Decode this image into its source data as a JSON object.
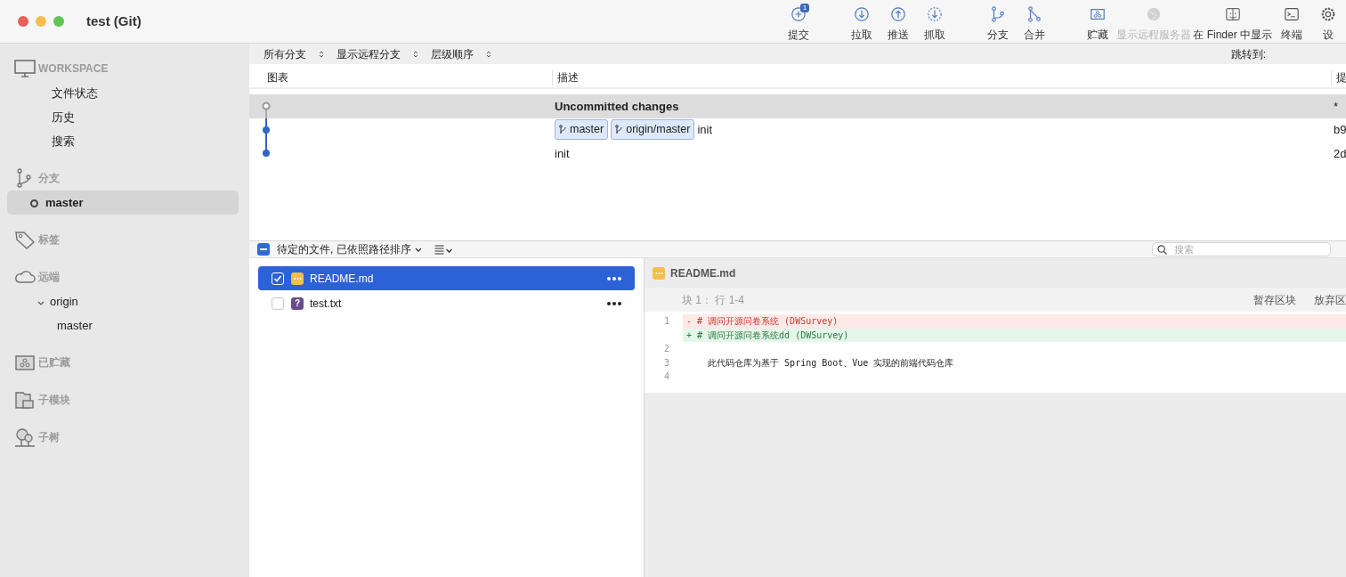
{
  "window": {
    "title": "test (Git)"
  },
  "toolbar": [
    {
      "label": "提交",
      "kind": "commit",
      "badge": "1",
      "disabled": false
    },
    {
      "label": "拉取",
      "kind": "pull",
      "disabled": false
    },
    {
      "label": "推送",
      "kind": "push",
      "disabled": false
    },
    {
      "label": "抓取",
      "kind": "fetch",
      "disabled": false
    },
    {
      "label": "分支",
      "kind": "branch",
      "disabled": false
    },
    {
      "label": "合并",
      "kind": "merge",
      "disabled": false
    },
    {
      "label": "贮藏",
      "kind": "stash",
      "disabled": false
    },
    {
      "label": "显示远程服务器",
      "kind": "remote",
      "disabled": true
    },
    {
      "label": "在 Finder 中显示",
      "kind": "finder",
      "disabled": false
    },
    {
      "label": "终端",
      "kind": "terminal",
      "disabled": false
    },
    {
      "label": "设",
      "kind": "settings",
      "disabled": false
    }
  ],
  "sidebar": {
    "sections": [
      {
        "label": "WORKSPACE",
        "kind": "workspace",
        "items": [
          {
            "label": "文件状态",
            "selected": false
          },
          {
            "label": "历史",
            "selected": false
          },
          {
            "label": "搜索",
            "selected": false
          }
        ]
      },
      {
        "label": "分支",
        "kind": "branch",
        "items": [
          {
            "label": "master",
            "selected": true,
            "current": true
          }
        ]
      },
      {
        "label": "标签",
        "kind": "tag"
      },
      {
        "label": "远端",
        "kind": "remote",
        "items": [
          {
            "label": "origin",
            "selected": false,
            "expanded": true,
            "children": [
              {
                "label": "master",
                "selected": false
              }
            ]
          }
        ]
      },
      {
        "label": "已贮藏",
        "kind": "stash"
      },
      {
        "label": "子模块",
        "kind": "submodule"
      },
      {
        "label": "子树",
        "kind": "subtree"
      }
    ]
  },
  "filters": {
    "selects": [
      "所有分支",
      "显示远程分支",
      "层级顺序"
    ],
    "jump_label": "跳转到:"
  },
  "commits": {
    "columns": [
      "图表",
      "描述",
      "提"
    ],
    "rows": [
      {
        "kind": "uncommitted",
        "description": "Uncommitted changes",
        "refs": [],
        "hash": "*",
        "selected": true
      },
      {
        "kind": "commit",
        "description": "init",
        "refs": [
          "master",
          "origin/master"
        ],
        "hash": "b9",
        "selected": false
      },
      {
        "kind": "commit",
        "description": "init",
        "refs": [],
        "hash": "2d",
        "selected": false
      }
    ]
  },
  "staged": {
    "select_all": {
      "checked": true,
      "mixed": true
    },
    "label": "待定的文件, 已依照路径排序",
    "search": {
      "placeholder": "搜索"
    },
    "files": [
      {
        "name": "README.md",
        "kind": "modified",
        "checked": true,
        "selected": true
      },
      {
        "name": "test.txt",
        "kind": "untracked",
        "glyph": "?",
        "checked": false,
        "selected": false
      }
    ]
  },
  "diff": {
    "file": "README.md",
    "hunk": "块 1：  行 1-4",
    "buttons": [
      "暂存区块",
      "放弃区"
    ],
    "lines": [
      {
        "kind": "removed",
        "number": "1",
        "sign": "-",
        "text": "# 调问开源问卷系统 (DWSurvey)"
      },
      {
        "kind": "added",
        "sign": "+",
        "text": "# 调问开源问卷系统dd (DWSurvey)"
      },
      {
        "kind": "context",
        "number": "2"
      },
      {
        "kind": "context",
        "number": "3",
        "text": "    此代码仓库为基于 Spring Boot、Vue 实现的前端代码仓库"
      },
      {
        "kind": "context",
        "number": "4"
      }
    ]
  }
}
